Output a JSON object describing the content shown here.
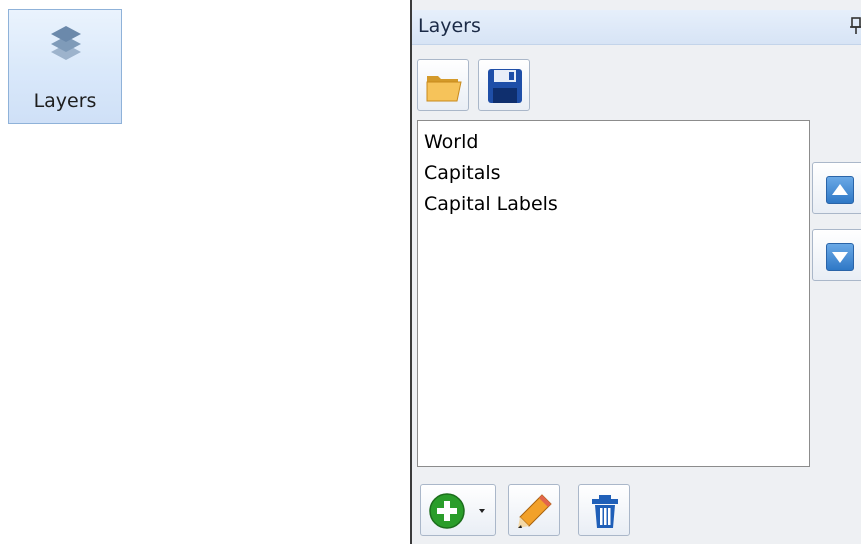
{
  "ribbon": {
    "layers_button_label": "Layers",
    "layers_icon": "layers-icon"
  },
  "panel": {
    "title": "Layers",
    "pin_icon": "pin-icon",
    "toolbar_top": [
      {
        "name": "open-folder-button",
        "icon": "folder-icon"
      },
      {
        "name": "save-button",
        "icon": "floppy-disk-icon"
      }
    ],
    "layers": [
      "World",
      "Capitals",
      "Capital Labels"
    ],
    "side_buttons": [
      {
        "name": "move-up-button",
        "icon": "arrow-up-icon"
      },
      {
        "name": "move-down-button",
        "icon": "arrow-down-icon"
      }
    ],
    "toolbar_bottom": [
      {
        "name": "add-layer-button",
        "icon": "plus-circle-icon",
        "dropdown": true
      },
      {
        "name": "edit-layer-button",
        "icon": "pencil-icon"
      },
      {
        "name": "delete-layer-button",
        "icon": "trash-icon"
      }
    ]
  },
  "colors": {
    "accent_blue": "#2f78c6",
    "add_green": "#2a9d2a",
    "panel_bg": "#eef0f3"
  }
}
